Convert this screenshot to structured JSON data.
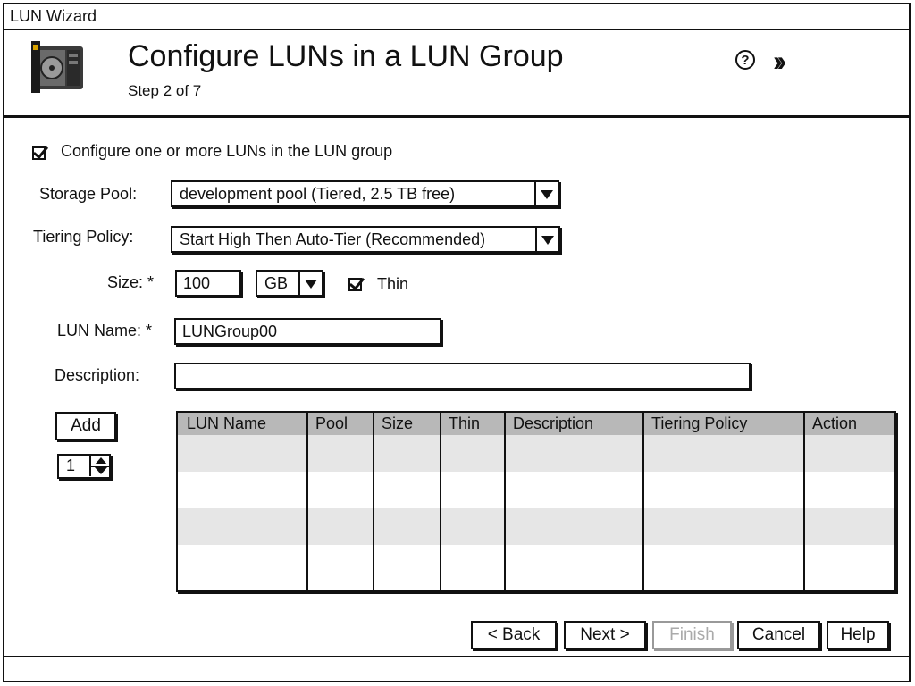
{
  "window": {
    "title": "LUN Wizard"
  },
  "header": {
    "title": "Configure LUNs in a LUN Group",
    "step": "Step 2 of 7",
    "icons": [
      "disk-drive-icon",
      "help-icon",
      "chevrons-icon"
    ],
    "help_glyph": "?",
    "chevrons_glyph": "››"
  },
  "form": {
    "configure_luns": {
      "label": "Configure one or more LUNs in the LUN group",
      "checked": true
    },
    "storage_pool": {
      "label": "Storage Pool:",
      "value": "development pool (Tiered, 2.5 TB free)"
    },
    "tiering_policy": {
      "label": "Tiering Policy:",
      "value": "Start High Then Auto-Tier (Recommended)"
    },
    "size": {
      "label": "Size: *",
      "value": "100",
      "unit": "GB",
      "thin_label": "Thin",
      "thin_checked": true
    },
    "lun_name": {
      "label": "LUN Name: *",
      "value": "LUNGroup00"
    },
    "description": {
      "label": "Description:",
      "value": ""
    }
  },
  "add": {
    "button_label": "Add",
    "count": "1"
  },
  "table": {
    "columns": [
      "LUN Name",
      "Pool",
      "Size",
      "Thin",
      "Description",
      "Tiering Policy",
      "Action"
    ],
    "rows": []
  },
  "buttons": {
    "back": "< Back",
    "next": "Next >",
    "finish": "Finish",
    "cancel": "Cancel",
    "help": "Help"
  }
}
